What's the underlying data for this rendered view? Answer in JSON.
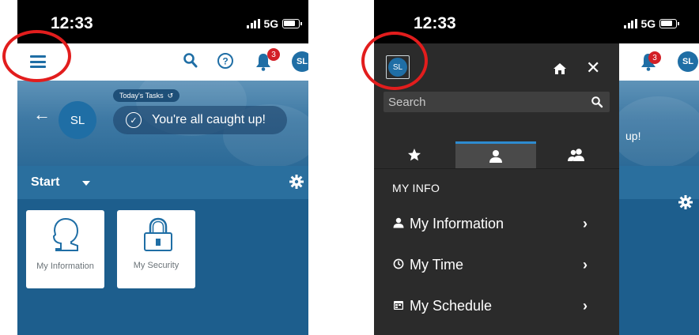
{
  "colors": {
    "brand_blue": "#1f6ea5",
    "badge_red": "#d32027",
    "highlight_ring": "#e21d1d",
    "drawer_bg": "#2b2b2b",
    "active_tab": "#2e8bd0"
  },
  "status_bar": {
    "time": "12:33",
    "network": "5G"
  },
  "left_screen": {
    "app_bar": {
      "menu_icon": "hamburger-icon",
      "search_icon": "search-icon",
      "help_icon": "help-icon",
      "notifications_count": "3",
      "avatar_initials": "SL"
    },
    "hero": {
      "avatar_initials": "SL",
      "tasks_pill": "Today's Tasks",
      "tasks_status": "You're all caught up!"
    },
    "start_bar": {
      "label": "Start"
    },
    "tiles": [
      {
        "label": "My Information",
        "icon": "person-silhouette-icon"
      },
      {
        "label": "My Security",
        "icon": "padlock-icon"
      }
    ]
  },
  "right_screen": {
    "drawer": {
      "avatar_initials": "SL",
      "search_placeholder": "Search",
      "tabs": [
        "favorites-tab",
        "my-info-tab",
        "team-tab"
      ],
      "section_title": "MY INFO",
      "items": [
        {
          "label": "My Information",
          "icon": "person-icon"
        },
        {
          "label": "My Time",
          "icon": "clock-icon"
        },
        {
          "label": "My Schedule",
          "icon": "calendar-icon"
        }
      ]
    },
    "background": {
      "partial_text": "up!",
      "notifications_count": "3",
      "avatar_initials": "SL"
    }
  }
}
